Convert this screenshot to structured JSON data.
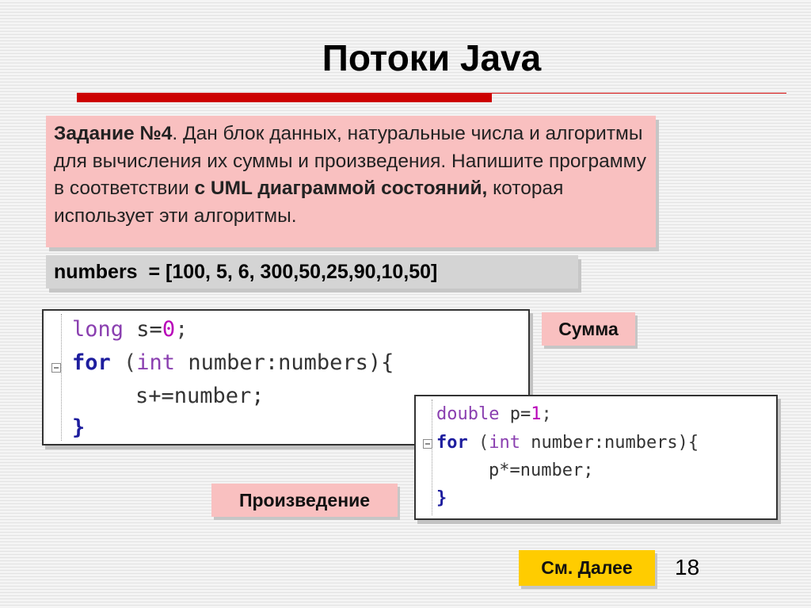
{
  "slide": {
    "title": "Потоки Java",
    "page_number": "18"
  },
  "task": {
    "label": "Задание №4",
    "text_1": ". Дан блок данных, натуральные числа и алгоритмы для вычисления их суммы и произведения. Напишите программу в соответствии ",
    "bold_1": "с UML диаграммой состояний,",
    "text_2": " которая использует эти алгоритмы."
  },
  "numbers_line": "numbers  = [100, 5, 6, 300,50,25,90,10,50]",
  "code_sum": {
    "line1": {
      "type": "long",
      "rest": " s=",
      "num": "0",
      "end": ";"
    },
    "line2": {
      "kw": "for",
      "open": " (",
      "type": "int",
      "rest": " number:numbers){"
    },
    "line3": "s+=number;",
    "line4": "}"
  },
  "code_product": {
    "line1": {
      "type": "double",
      "rest": " p=",
      "num": "1",
      "end": ";"
    },
    "line2": {
      "kw": "for",
      "open": " (",
      "type": "int",
      "rest": " number:numbers){"
    },
    "line3": "p*=number;",
    "line4": "}"
  },
  "labels": {
    "sum": "Сумма",
    "product": "Произведение",
    "next": "См. Далее"
  },
  "colors": {
    "title_bar": "#cc0000",
    "task_bg": "#f9c0c0",
    "numbers_bg": "#d4d4d4",
    "next_button_bg": "#ffcc00",
    "keyword": "#1d1d9e",
    "type": "#8a3fb0",
    "number_literal": "#b800b8"
  }
}
